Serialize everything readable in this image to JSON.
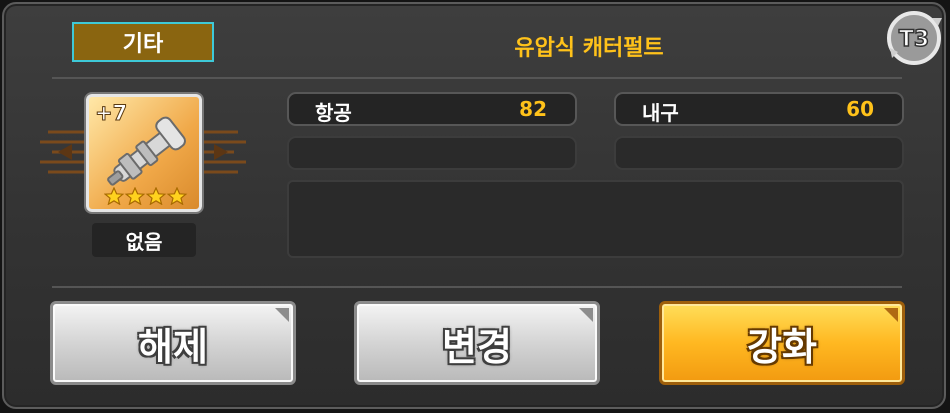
{
  "header": {
    "category_label": "기타",
    "item_name": "유압식 캐터펄트",
    "tier_badge": "T3"
  },
  "item": {
    "level_label": "+7",
    "stars": 4,
    "equipped_by": "없음",
    "icon": "catapult-icon"
  },
  "stats": [
    {
      "label": "항공",
      "value": "82"
    },
    {
      "label": "내구",
      "value": "60"
    }
  ],
  "buttons": {
    "unequip": "해제",
    "change": "변경",
    "enhance": "강화"
  },
  "colors": {
    "accent_gold": "#ffc21a",
    "category_border": "#3ec9d8",
    "category_bg": "#8a6510",
    "enhance_button": "#ffb821"
  }
}
